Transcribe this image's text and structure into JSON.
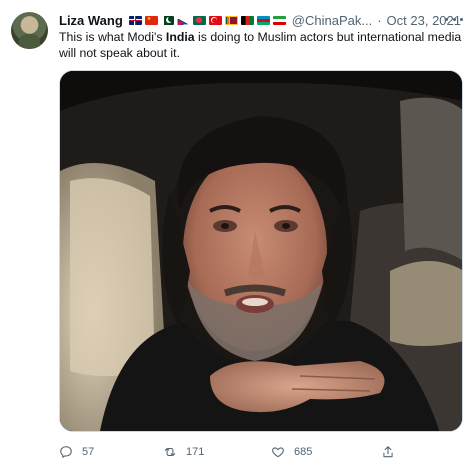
{
  "tweet": {
    "author_name": "Liza Wang",
    "handle": "@ChinaPak...",
    "separator": "·",
    "date": "Oct 23, 2021",
    "flags": [
      "uk-flag",
      "china-flag",
      "pakistan-flag",
      "nepal-flag",
      "bangladesh-flag",
      "turkey-flag",
      "sri-lanka-flag",
      "afghanistan-flag",
      "azerbaijan-flag",
      "iran-flag"
    ],
    "text_before": "This is what Modi's ",
    "text_bold": "India",
    "text_after": " is doing to Muslim actors but international media will not speak about it.",
    "media_description_icon": "photo-of-man-in-car"
  },
  "actions": {
    "reply_count": "57",
    "retweet_count": "171",
    "like_count": "685"
  },
  "colors": {
    "text_primary": "#0f1419",
    "text_secondary": "#536471",
    "border": "#cfd9de"
  }
}
